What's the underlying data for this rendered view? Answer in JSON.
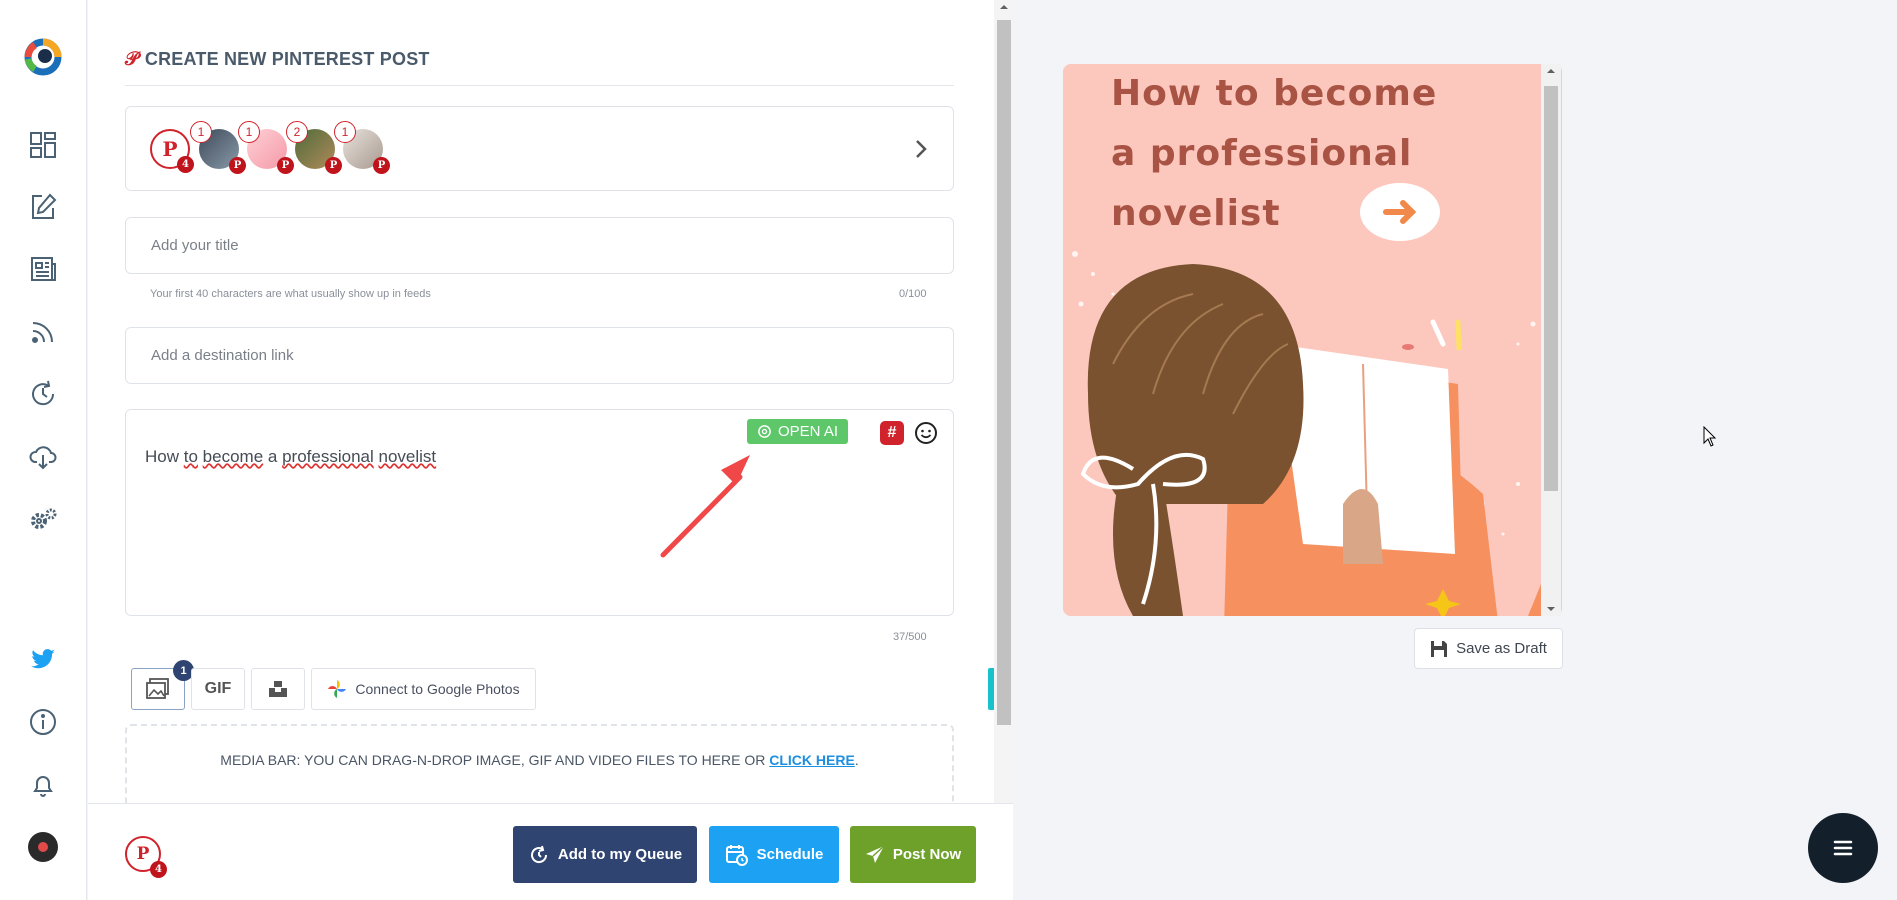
{
  "header": {
    "title": "CREATE NEW PINTEREST POST"
  },
  "accounts": {
    "pinterest_count": "4",
    "profiles": [
      {
        "count": "1",
        "color": "#4a5a6a"
      },
      {
        "count": "1",
        "color": "#f4a7b0"
      },
      {
        "count": "2",
        "color": "#6b5a3a"
      },
      {
        "count": "1",
        "color": "#c9c0b8"
      }
    ]
  },
  "title_field": {
    "placeholder": "Add your title",
    "hint": "Your first 40 characters are what usually show up in feeds",
    "counter": "0/100"
  },
  "link_field": {
    "placeholder": "Add a destination link"
  },
  "post": {
    "words": [
      "How",
      "to",
      "become",
      "a",
      "professional",
      "novelist"
    ],
    "counter": "37/500",
    "openai_label": "OPEN AI",
    "hashtag_label": "#"
  },
  "media": {
    "image_count": "1",
    "gif_label": "GIF",
    "google_photos_label": "Connect to Google Photos",
    "canva_label": "C",
    "dropzone_text": "MEDIA BAR: YOU CAN DRAG-N-DROP IMAGE, GIF AND VIDEO FILES TO HERE OR ",
    "dropzone_link": "CLICK HERE",
    "dropzone_end": "."
  },
  "bottom": {
    "pinterest_count": "4",
    "queue_label": "Add to my Queue",
    "schedule_label": "Schedule",
    "post_now_label": "Post Now"
  },
  "preview": {
    "title_lines": [
      "How to become",
      "a professional",
      "novelist"
    ]
  },
  "draft": {
    "label": "Save as Draft"
  },
  "colors": {
    "queue": "#2f4470",
    "schedule": "#1da1f2",
    "post_now": "#6ea12a",
    "pinterest": "#d0232b",
    "openai": "#5ec76a",
    "canva": "#17c2cb"
  }
}
